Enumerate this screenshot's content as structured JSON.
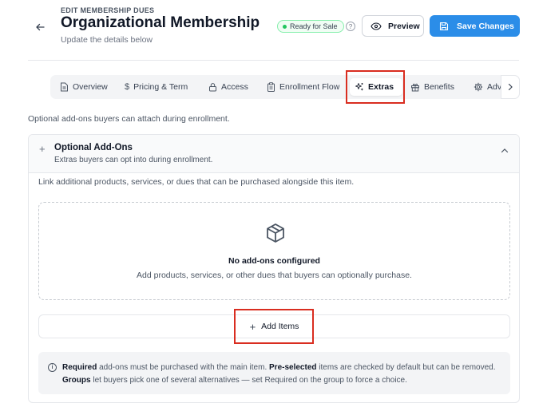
{
  "header": {
    "eyebrow": "EDIT MEMBERSHIP DUES",
    "title": "Organizational Membership",
    "subtitle": "Update the details below",
    "status": "Ready for Sale",
    "preview_label": "Preview",
    "save_label": "Save Changes",
    "accent_color": "#2b8de8",
    "status_color": "#22c55e"
  },
  "tabs": [
    {
      "label": "Overview",
      "icon": "document-icon"
    },
    {
      "label": "Pricing & Term",
      "icon": "dollar-icon"
    },
    {
      "label": "Access",
      "icon": "lock-icon"
    },
    {
      "label": "Enrollment Flow",
      "icon": "clipboard-icon"
    },
    {
      "label": "Extras",
      "icon": "sparkles-icon",
      "active": true
    },
    {
      "label": "Benefits",
      "icon": "gift-icon"
    },
    {
      "label": "Adv",
      "icon": "gear-icon"
    }
  ],
  "section": {
    "description": "Optional add-ons buyers can attach during enrollment."
  },
  "addons": {
    "title": "Optional Add-Ons",
    "subtitle": "Extras buyers can opt into during enrollment.",
    "link_text": "Link additional products, services, or dues that can be purchased alongside this item.",
    "empty_title": "No add-ons configured",
    "empty_desc": "Add products, services, or other dues that buyers can optionally purchase.",
    "add_button": "Add Items",
    "info": {
      "t1": "Required",
      "t2": " add-ons must be purchased with the main item. ",
      "t3": "Pre-selected",
      "t4": " items are checked by default but can be removed. ",
      "t5": "Groups",
      "t6": " let buyers pick one of several alternatives — set Required on the group to force a choice."
    }
  }
}
